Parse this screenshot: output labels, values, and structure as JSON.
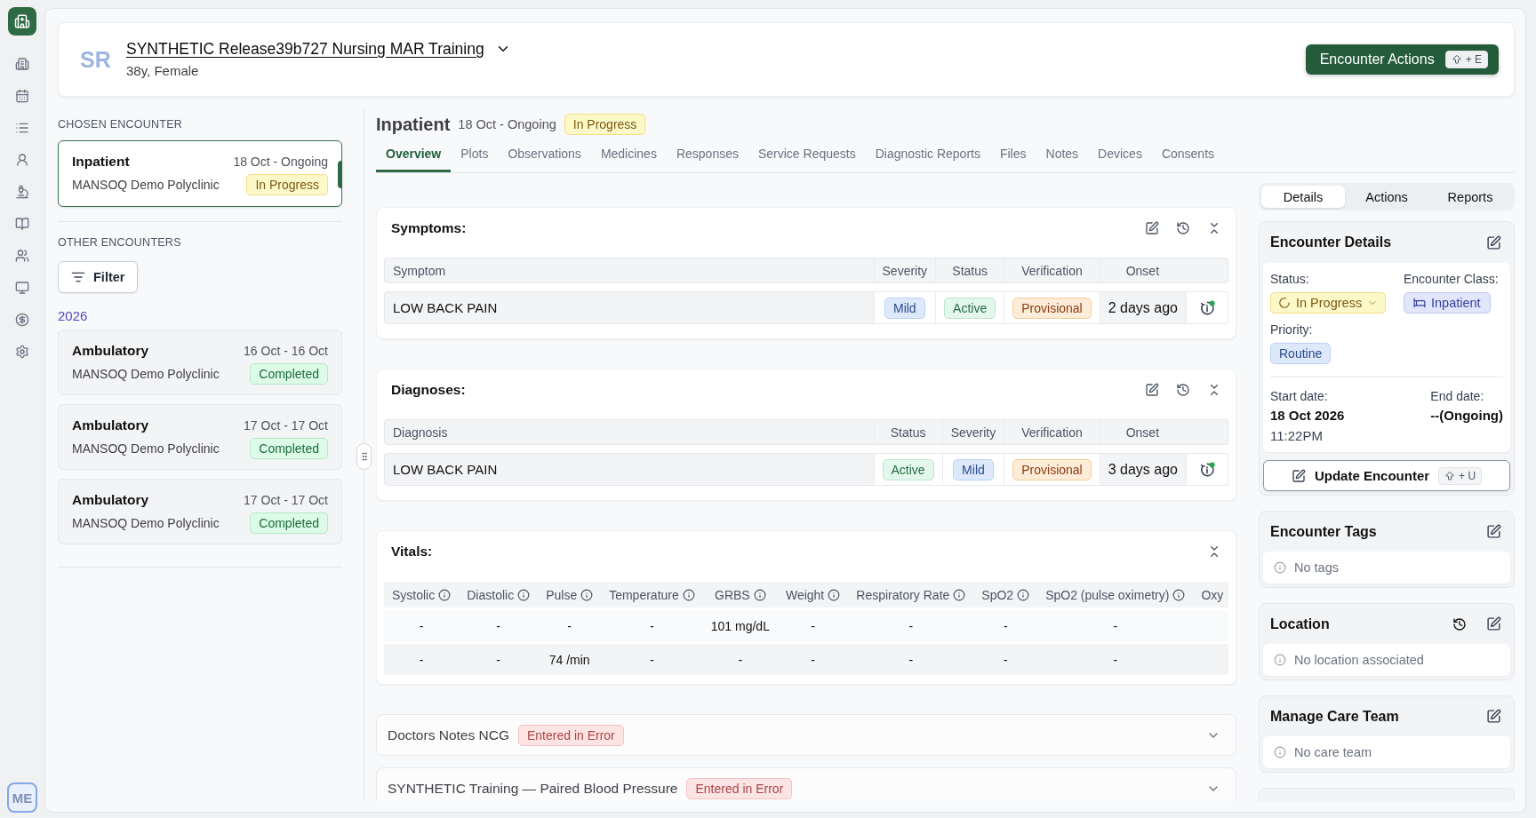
{
  "nav_rail": {
    "avatar": "ME"
  },
  "patient_header": {
    "initials": "SR",
    "name": "SYNTHETIC Release39b727 Nursing MAR Training",
    "details": "38y, Female",
    "action_button": {
      "label": "Encounter Actions",
      "shortcut": "+ E"
    }
  },
  "encounter_list": {
    "chosen_heading": "CHOSEN ENCOUNTER",
    "chosen": {
      "type": "Inpatient",
      "dates": "18 Oct - Ongoing",
      "facility": "MANSOQ Demo Polyclinic",
      "status": {
        "label": "In Progress",
        "kind": "in_progress"
      },
      "selected": true
    },
    "others_heading": "OTHER ENCOUNTERS",
    "filter_button": "Filter",
    "year": "2026",
    "others": [
      {
        "type": "Ambulatory",
        "dates": "16 Oct - 16 Oct",
        "facility": "MANSOQ Demo Polyclinic",
        "status": {
          "label": "Completed",
          "kind": "completed"
        },
        "selected": false
      },
      {
        "type": "Ambulatory",
        "dates": "17 Oct - 17 Oct",
        "facility": "MANSOQ Demo Polyclinic",
        "status": {
          "label": "Completed",
          "kind": "completed"
        },
        "selected": false
      },
      {
        "type": "Ambulatory",
        "dates": "17 Oct - 17 Oct",
        "facility": "MANSOQ Demo Polyclinic",
        "status": {
          "label": "Completed",
          "kind": "completed"
        },
        "selected": false
      }
    ]
  },
  "encounter_view": {
    "title": "Inpatient",
    "dates": "18 Oct - Ongoing",
    "status": {
      "label": "In Progress",
      "kind": "in_progress"
    },
    "tabs": [
      {
        "label": "Overview",
        "selected": true
      },
      {
        "label": "Plots",
        "selected": false
      },
      {
        "label": "Observations",
        "selected": false
      },
      {
        "label": "Medicines",
        "selected": false
      },
      {
        "label": "Responses",
        "selected": false
      },
      {
        "label": "Service Requests",
        "selected": false
      },
      {
        "label": "Diagnostic Reports",
        "selected": false
      },
      {
        "label": "Files",
        "selected": false
      },
      {
        "label": "Notes",
        "selected": false
      },
      {
        "label": "Devices",
        "selected": false
      },
      {
        "label": "Consents",
        "selected": false
      }
    ],
    "symptoms": {
      "title": "Symptoms:",
      "columns": [
        "Symptom",
        "Severity",
        "Status",
        "Verification",
        "Onset"
      ],
      "rows": [
        {
          "name": "LOW BACK PAIN",
          "badges": [
            {
              "label": "Mild",
              "kind": "mild"
            },
            {
              "label": "Active",
              "kind": "active"
            },
            {
              "label": "Provisional",
              "kind": "provisional"
            }
          ],
          "onset": "2 days ago"
        }
      ]
    },
    "diagnoses": {
      "title": "Diagnoses:",
      "columns": [
        "Diagnosis",
        "Status",
        "Severity",
        "Verification",
        "Onset"
      ],
      "rows": [
        {
          "name": "LOW BACK PAIN",
          "badges": [
            {
              "label": "Active",
              "kind": "active"
            },
            {
              "label": "Mild",
              "kind": "mild"
            },
            {
              "label": "Provisional",
              "kind": "provisional"
            }
          ],
          "onset": "3 days ago"
        }
      ]
    },
    "vitals": {
      "title": "Vitals:",
      "columns": [
        {
          "label": "Systolic",
          "info": true
        },
        {
          "label": "Diastolic",
          "info": true
        },
        {
          "label": "Pulse",
          "info": true
        },
        {
          "label": "Temperature",
          "info": true
        },
        {
          "label": "GRBS",
          "info": true
        },
        {
          "label": "Weight",
          "info": true
        },
        {
          "label": "Respiratory Rate",
          "info": true
        },
        {
          "label": "SpO2",
          "info": true
        },
        {
          "label": "SpO2 (pulse oximetry)",
          "info": true
        },
        {
          "label": "Oxy",
          "info": false
        }
      ],
      "rows": [
        [
          "-",
          "-",
          "-",
          "-",
          "101 mg/dL",
          "-",
          "-",
          "-",
          "-"
        ],
        [
          "-",
          "-",
          "74 /min",
          "-",
          "-",
          "-",
          "-",
          "-",
          "-"
        ]
      ]
    },
    "notes": [
      {
        "title": "Doctors Notes NCG",
        "status": {
          "label": "Entered in Error",
          "kind": "entered_in_error"
        },
        "expanded": false
      },
      {
        "title": "SYNTHETIC Training — Paired Blood Pressure",
        "status": {
          "label": "Entered in Error",
          "kind": "entered_in_error"
        },
        "expanded": false
      }
    ]
  },
  "side_panel": {
    "tabs": [
      {
        "label": "Details",
        "selected": true
      },
      {
        "label": "Actions",
        "selected": false
      },
      {
        "label": "Reports",
        "selected": false
      }
    ],
    "encounter_details": {
      "title": "Encounter Details",
      "status_label": "Status:",
      "status": {
        "label": "In Progress",
        "kind": "in_progress"
      },
      "class_label": "Encounter Class:",
      "class": {
        "label": "Inpatient",
        "kind": "encounter_class"
      },
      "priority_label": "Priority:",
      "priority": {
        "label": "Routine",
        "kind": "routine"
      },
      "start_label": "Start date:",
      "start_date": "18 Oct 2026",
      "start_time": "11:22PM",
      "end_label": "End date:",
      "end_date": "--(Ongoing)",
      "update_button": {
        "label": "Update Encounter",
        "shortcut": "+ U"
      }
    },
    "cards": [
      {
        "title": "Encounter Tags",
        "empty_text": "No tags",
        "history": false
      },
      {
        "title": "Location",
        "empty_text": "No location associated",
        "history": true
      },
      {
        "title": "Manage Care Team",
        "empty_text": "No care team",
        "history": false
      }
    ]
  }
}
